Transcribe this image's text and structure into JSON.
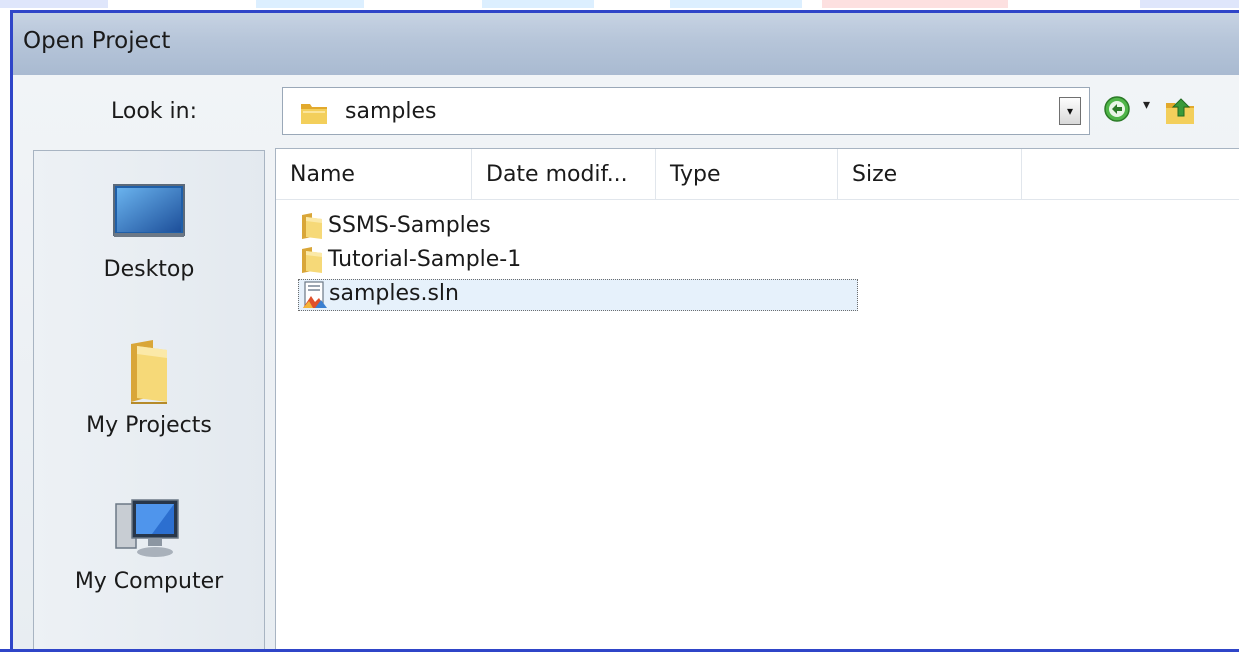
{
  "dialog": {
    "title": "Open Project"
  },
  "lookin": {
    "label": "Look in:",
    "current_folder": "samples",
    "dropdown_glyph": "▾"
  },
  "toolbar": {
    "back_icon": "back-arrow-icon",
    "back_dropdown_glyph": "▾",
    "up_folder_icon": "up-folder-icon"
  },
  "places": [
    {
      "label": "Desktop",
      "icon": "desktop-icon"
    },
    {
      "label": "My Projects",
      "icon": "folder-icon"
    },
    {
      "label": "My Computer",
      "icon": "computer-icon"
    }
  ],
  "columns": [
    {
      "label": "Name"
    },
    {
      "label": "Date modif..."
    },
    {
      "label": "Type"
    },
    {
      "label": "Size"
    }
  ],
  "files": [
    {
      "name": "SSMS-Samples",
      "icon": "folder-icon",
      "selected": false
    },
    {
      "name": "Tutorial-Sample-1",
      "icon": "folder-icon",
      "selected": false
    },
    {
      "name": "samples.sln",
      "icon": "solution-file-icon",
      "selected": true
    }
  ],
  "colors": {
    "frame_border": "#2f45c8",
    "titlebar": "#b6c5d9",
    "selection_bg": "#e6f1fb",
    "folder_yellow": "#f1c84a"
  }
}
